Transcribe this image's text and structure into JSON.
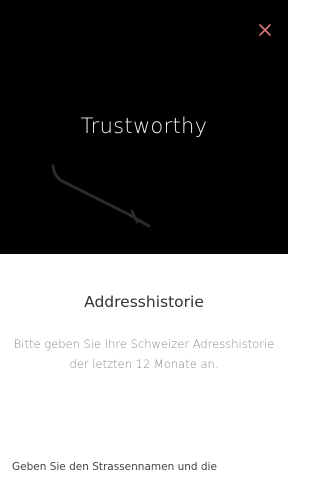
{
  "header": {
    "brand_title": "Trustworthy",
    "close_icon": "close-icon",
    "accent_color": "#d9777f"
  },
  "content": {
    "title": "Addresshistorie",
    "description": "Bitte geben Sie Ihre Schweizer Adresshistorie der letzten 12 Monate an.",
    "hint": "Geben Sie den Strassennamen und die"
  }
}
